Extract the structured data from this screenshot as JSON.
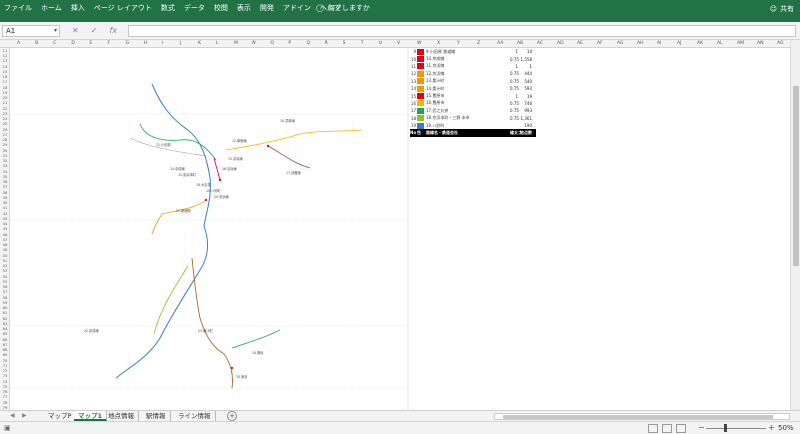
{
  "ribbon": {
    "tabs": [
      "ファイル",
      "ホーム",
      "挿入",
      "ページ レイアウト",
      "数式",
      "データ",
      "校閲",
      "表示",
      "開発",
      "アドイン",
      "ヘルプ"
    ],
    "tell_me": "何をしますか",
    "share": "共有"
  },
  "formula_bar": {
    "name_box": "A1",
    "formula": ""
  },
  "columns": {
    "left": [
      "A",
      "B",
      "C",
      "D",
      "E",
      "F",
      "G",
      "H",
      "I",
      "J",
      "K",
      "L",
      "M",
      "N",
      "O",
      "P",
      "Q",
      "R",
      "S",
      "T",
      "U",
      "V"
    ],
    "right": [
      "W",
      "X",
      "Y",
      "Z",
      "AA",
      "AB",
      "AC",
      "AD",
      "AE",
      "AF",
      "AG",
      "AH",
      "AI",
      "AJ",
      "AK",
      "AL",
      "AM",
      "AN",
      "AO"
    ]
  },
  "rows": [
    "11",
    "12",
    "13",
    "14",
    "15",
    "16",
    "17",
    "18",
    "19",
    "20",
    "21",
    "22",
    "23",
    "24",
    "25",
    "26",
    "27",
    "28",
    "29",
    "30",
    "31",
    "32",
    "33",
    "34",
    "35",
    "36",
    "37",
    "38",
    "39",
    "40",
    "41",
    "42",
    "43",
    "44",
    "45",
    "46",
    "47",
    "48",
    "49",
    "50",
    "51",
    "52",
    "53",
    "54",
    "55",
    "56",
    "57",
    "58",
    "59",
    "60",
    "61",
    "62",
    "63",
    "64",
    "65",
    "66",
    "67",
    "68",
    "69",
    "70",
    "71",
    "72",
    "73",
    "74",
    "75",
    "76",
    "77",
    "78",
    "79"
  ],
  "table": {
    "rows": [
      {
        "no": "9",
        "color": "#e60012",
        "name": "9.小田原 鉄道線",
        "w": "1",
        "d": "14"
      },
      {
        "no": "10",
        "color": "#e60012",
        "name": "10.京成線",
        "w": "0.75",
        "d": "1,558"
      },
      {
        "no": "11",
        "color": "#e60012",
        "name": "11.京浜線",
        "w": "1",
        "d": "1"
      },
      {
        "no": "12",
        "color": "#f39800",
        "name": "12.京浜線",
        "w": "0.75",
        "d": "444"
      },
      {
        "no": "13",
        "color": "#f39800",
        "name": "13.桑汁町",
        "w": "0.75",
        "d": "540"
      },
      {
        "no": "14",
        "color": "#f39800",
        "name": "14.桑汁町",
        "w": "0.75",
        "d": "593"
      },
      {
        "no": "15",
        "color": "#e60012",
        "name": "15.豊原市",
        "w": "1",
        "d": "19"
      },
      {
        "no": "16",
        "color": "#f8b500",
        "name": "16.豊原市",
        "w": "0.75",
        "d": "746"
      },
      {
        "no": "17",
        "color": "#1fa84f",
        "name": "17.武之丸茶",
        "w": "0.75",
        "d": "993"
      },
      {
        "no": "18",
        "color": "#8fc31f",
        "name": "18.京浜本町・三野 本市",
        "w": "0.75",
        "d": "1,361"
      },
      {
        "no": "19",
        "color": "#3a7fc1",
        "name": "19.ハ鈴町",
        "w": "",
        "d": "190"
      }
    ],
    "header": {
      "no": "No",
      "color": "色",
      "name": "路線名・鉄道会社",
      "w": "線太さ",
      "d": "地点数"
    }
  },
  "map_labels": [
    "10.豊原線",
    "11.小田原",
    "12.新宿線",
    "13.京浜線",
    "14.京成線",
    "15.京浜本町",
    "16.京浜線",
    "17.武蔵線",
    "18.大丸茶",
    "19.ハ鈴町",
    "20.京浜線",
    "21.新宿駅",
    "22.京成線",
    "23.桑汁町",
    "24.横浜",
    "25.東京"
  ],
  "sheet_tabs": [
    "マップP",
    "マップ1",
    "地点情報",
    "駅情報",
    "ライン情報"
  ],
  "active_tab": "マップ1",
  "zoom": "50%"
}
